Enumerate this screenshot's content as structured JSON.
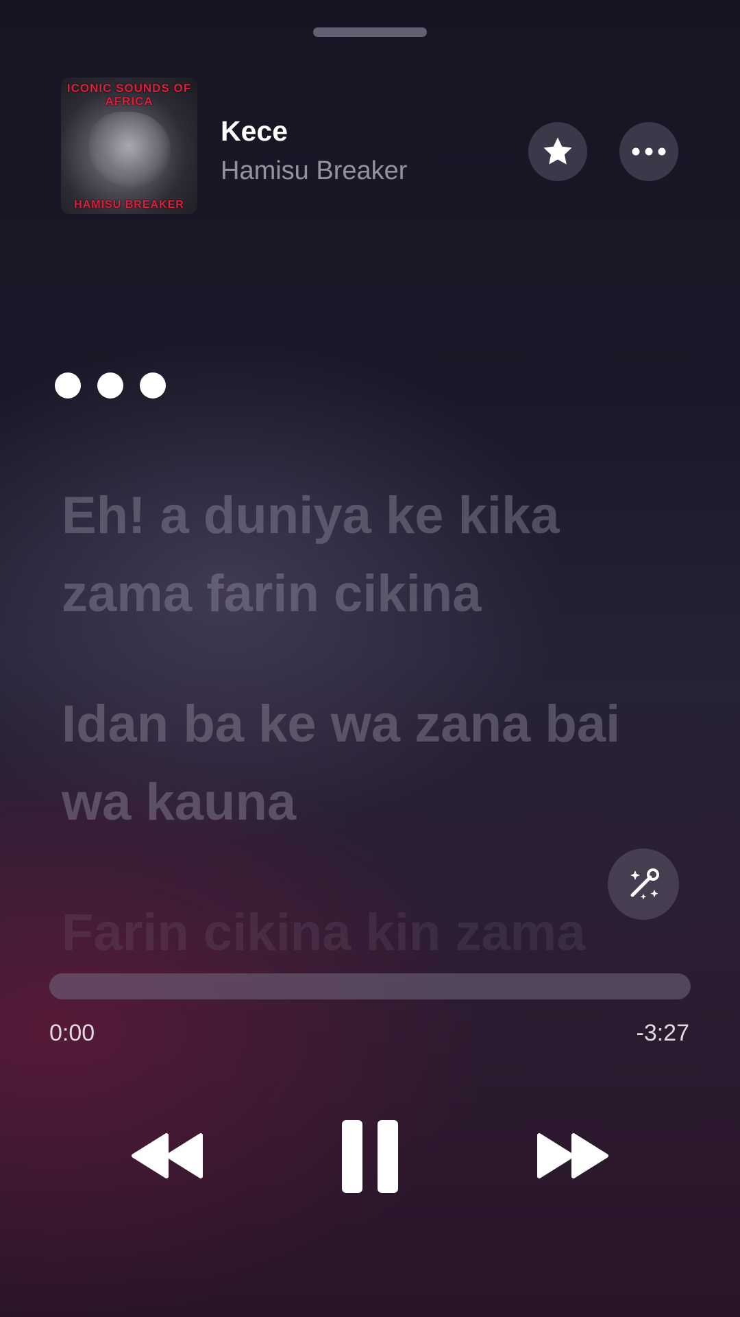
{
  "player": {
    "album_art": {
      "top_text": "ICONIC SOUNDS OF AFRICA",
      "bottom_text": "HAMISU BREAKER"
    },
    "track_title": "Kece",
    "artist": "Hamisu Breaker",
    "star_icon": "star-icon",
    "more_icon": "ellipsis-icon"
  },
  "lyrics": {
    "waiting_indicator": "dots",
    "lines": [
      "Eh! a duniya ke kika zama farin cikina",
      "Idan ba ke wa zana bai wa kauna",
      "Farin cikina kin zama"
    ]
  },
  "lyrics_button_icon": "microphone-sparkle-icon",
  "progress": {
    "elapsed": "0:00",
    "remaining": "-3:27",
    "fraction": 0
  },
  "controls": {
    "rewind_icon": "rewind-icon",
    "pause_icon": "pause-icon",
    "forward_icon": "fast-forward-icon"
  },
  "colors": {
    "accent": "#ffffff",
    "art_red": "#e01e3c"
  }
}
